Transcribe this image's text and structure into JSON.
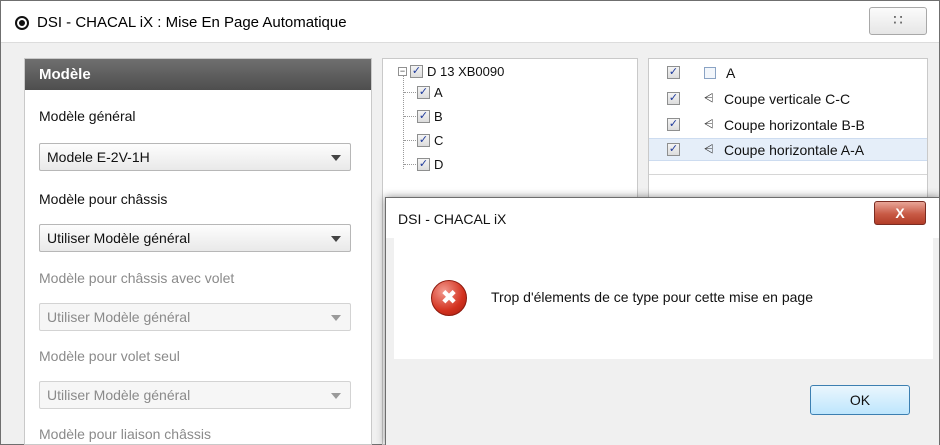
{
  "main_window": {
    "title": "DSI - CHACAL iX : Mise En Page Automatique",
    "close_symbol": "∷"
  },
  "left_panel": {
    "section_title": "Modèle",
    "fields": [
      {
        "label": "Modèle général",
        "value": "Modele E-2V-1H",
        "enabled": true
      },
      {
        "label": "Modèle pour châssis",
        "value": "Utiliser Modèle général",
        "enabled": true
      },
      {
        "label": "Modèle pour châssis avec volet",
        "value": "Utiliser Modèle général",
        "enabled": false
      },
      {
        "label": "Modèle pour volet seul",
        "value": "Utiliser Modèle général",
        "enabled": false
      }
    ],
    "partial_label": "Modèle pour liaison châssis"
  },
  "tree": {
    "root": {
      "label": "D 13 XB0090",
      "checked": true,
      "expander": "−"
    },
    "children": [
      {
        "label": "A",
        "checked": true
      },
      {
        "label": "B",
        "checked": true
      },
      {
        "label": "C",
        "checked": true
      },
      {
        "label": "D",
        "checked": true
      }
    ]
  },
  "views_list": {
    "items": [
      {
        "label": "A",
        "checked": true,
        "icon": "plain-view-icon",
        "glyph": ""
      },
      {
        "label": "Coupe verticale C-C",
        "checked": true,
        "icon": "section-cut-icon",
        "glyph": "⩤"
      },
      {
        "label": "Coupe horizontale B-B",
        "checked": true,
        "icon": "section-cut-icon",
        "glyph": "⩤"
      },
      {
        "label": "Coupe horizontale A-A",
        "checked": true,
        "icon": "section-cut-icon",
        "glyph": "⩤",
        "selected": true
      }
    ]
  },
  "dialog": {
    "title": "DSI - CHACAL iX",
    "close_symbol": "X",
    "icon": "error-icon",
    "icon_glyph": "✖",
    "message": "Trop d'élements de ce type pour cette mise en page",
    "ok_label": "OK"
  },
  "colors": {
    "section_header": "#5a5a5a",
    "dialog_close": "#c85a45",
    "error_red": "#d3321f",
    "selection": "#e5eef9"
  }
}
